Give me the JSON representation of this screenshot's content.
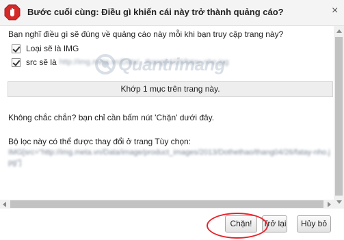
{
  "dialog": {
    "title": "Bước cuối cùng: Điều gì khiến cái này trở thành quảng cáo?",
    "close_glyph": "×"
  },
  "content": {
    "question": "Bạn nghĩ điều gì sẽ đúng về quảng cáo này mỗi khi bạn truy cập trang này?",
    "options": [
      {
        "label": "Loại sẽ là IMG",
        "checked": true
      },
      {
        "label": "src sẽ là",
        "value": "http://img.meta.vn/Data/...thang04/26/fatay-nho.jpg",
        "checked": true
      }
    ],
    "match_text": "Khớp 1 mục trên trang này.",
    "hint": "Không chắc chắn? bạn chỉ cần bấm nút 'Chặn' dưới đây.",
    "filter_label": "Bộ lọc này có thể được thay đổi ở trang Tùy chọn:",
    "filter_value": "IMG[src=\"http://img.meta.vn/Data/image/product_images/2013/Dothethao/thang04/26/fatay-nho.jpg\"]"
  },
  "watermark": {
    "text": "Quantrimang"
  },
  "buttons": {
    "block": "Chặn!",
    "back": "Trở lại",
    "cancel": "Hủy bỏ"
  },
  "colors": {
    "stop_icon": "#d42a2a",
    "highlight_ring": "#e8222a",
    "titlebar_bg": "#f4f4f4"
  },
  "icons": {
    "title_icon": "stop-hand-icon",
    "close": "close-icon"
  }
}
